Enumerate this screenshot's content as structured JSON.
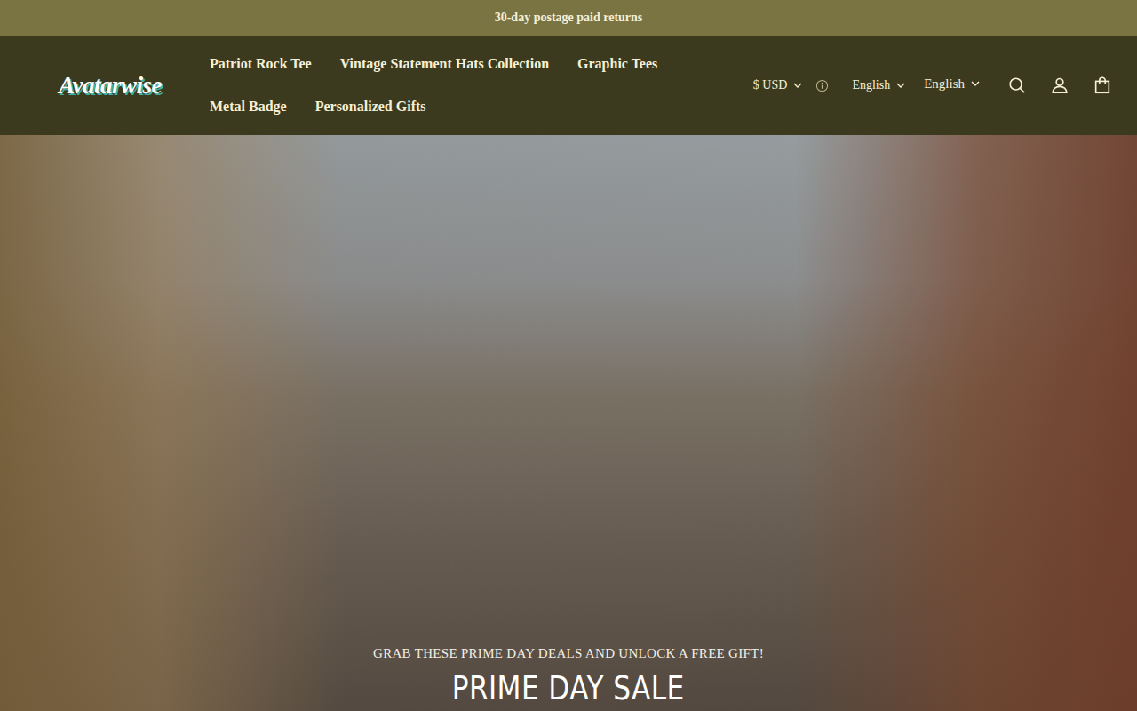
{
  "announcement": "30-day postage paid returns",
  "logo": "Avatarwise",
  "nav": [
    {
      "label": "Patriot Rock Tee"
    },
    {
      "label": "Vintage Statement Hats Collection"
    },
    {
      "label": "Graphic Tees"
    },
    {
      "label": "Metal Badge"
    },
    {
      "label": "Personalized Gifts"
    }
  ],
  "currency": {
    "label": "$ USD"
  },
  "languages": [
    {
      "label": "English"
    },
    {
      "label": "English"
    }
  ],
  "hero": {
    "kicker": "GRAB THESE PRIME DAY DEALS AND UNLOCK A FREE GIFT!",
    "title": "PRIME DAY SALE"
  }
}
